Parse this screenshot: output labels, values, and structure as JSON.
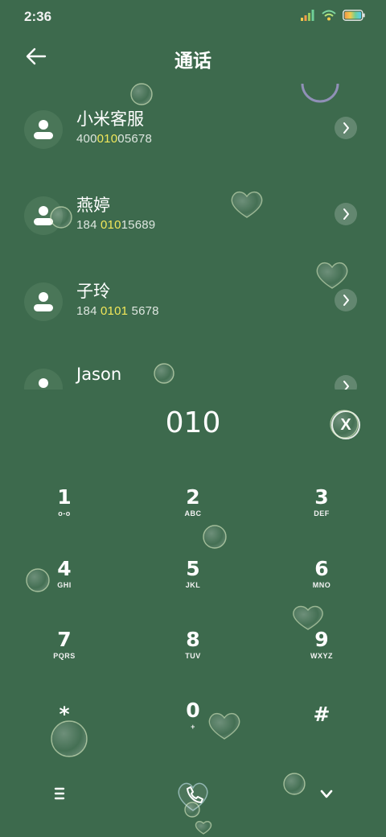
{
  "status_bar": {
    "time": "2:36",
    "icons": [
      "signal-icon",
      "wifi-icon",
      "battery-icon"
    ]
  },
  "header": {
    "title": "通话",
    "back_icon": "arrow-left-icon"
  },
  "contacts": [
    {
      "name": "小米客服",
      "number_pre": "400",
      "number_hl": "010",
      "number_post": "05678"
    },
    {
      "name": "燕婷",
      "number_pre": "184 ",
      "number_hl": "010",
      "number_post": "15689"
    },
    {
      "name": "子玲",
      "number_pre": "184 ",
      "number_hl": "0101",
      "number_post": " 5678"
    },
    {
      "name": "Jason",
      "number_pre": "",
      "number_hl": "",
      "number_post": ""
    }
  ],
  "dialer": {
    "input_value": "010",
    "clear_label": "X",
    "keys": [
      {
        "num": "1",
        "sub": "o-o"
      },
      {
        "num": "2",
        "sub": "ABC"
      },
      {
        "num": "3",
        "sub": "DEF"
      },
      {
        "num": "4",
        "sub": "GHI"
      },
      {
        "num": "5",
        "sub": "JKL"
      },
      {
        "num": "6",
        "sub": "MNO"
      },
      {
        "num": "7",
        "sub": "PQRS"
      },
      {
        "num": "8",
        "sub": "TUV"
      },
      {
        "num": "9",
        "sub": "WXYZ"
      },
      {
        "num": "*",
        "sub": ""
      },
      {
        "num": "0",
        "sub": "+"
      },
      {
        "num": "#",
        "sub": ""
      }
    ]
  },
  "bottom_bar": {
    "menu_icon": "menu-icon",
    "call_icon": "phone-icon",
    "collapse_icon": "chevron-down-icon"
  },
  "colors": {
    "background": "#3d6a4d",
    "highlight": "#f1e75a",
    "text": "#ffffff"
  }
}
